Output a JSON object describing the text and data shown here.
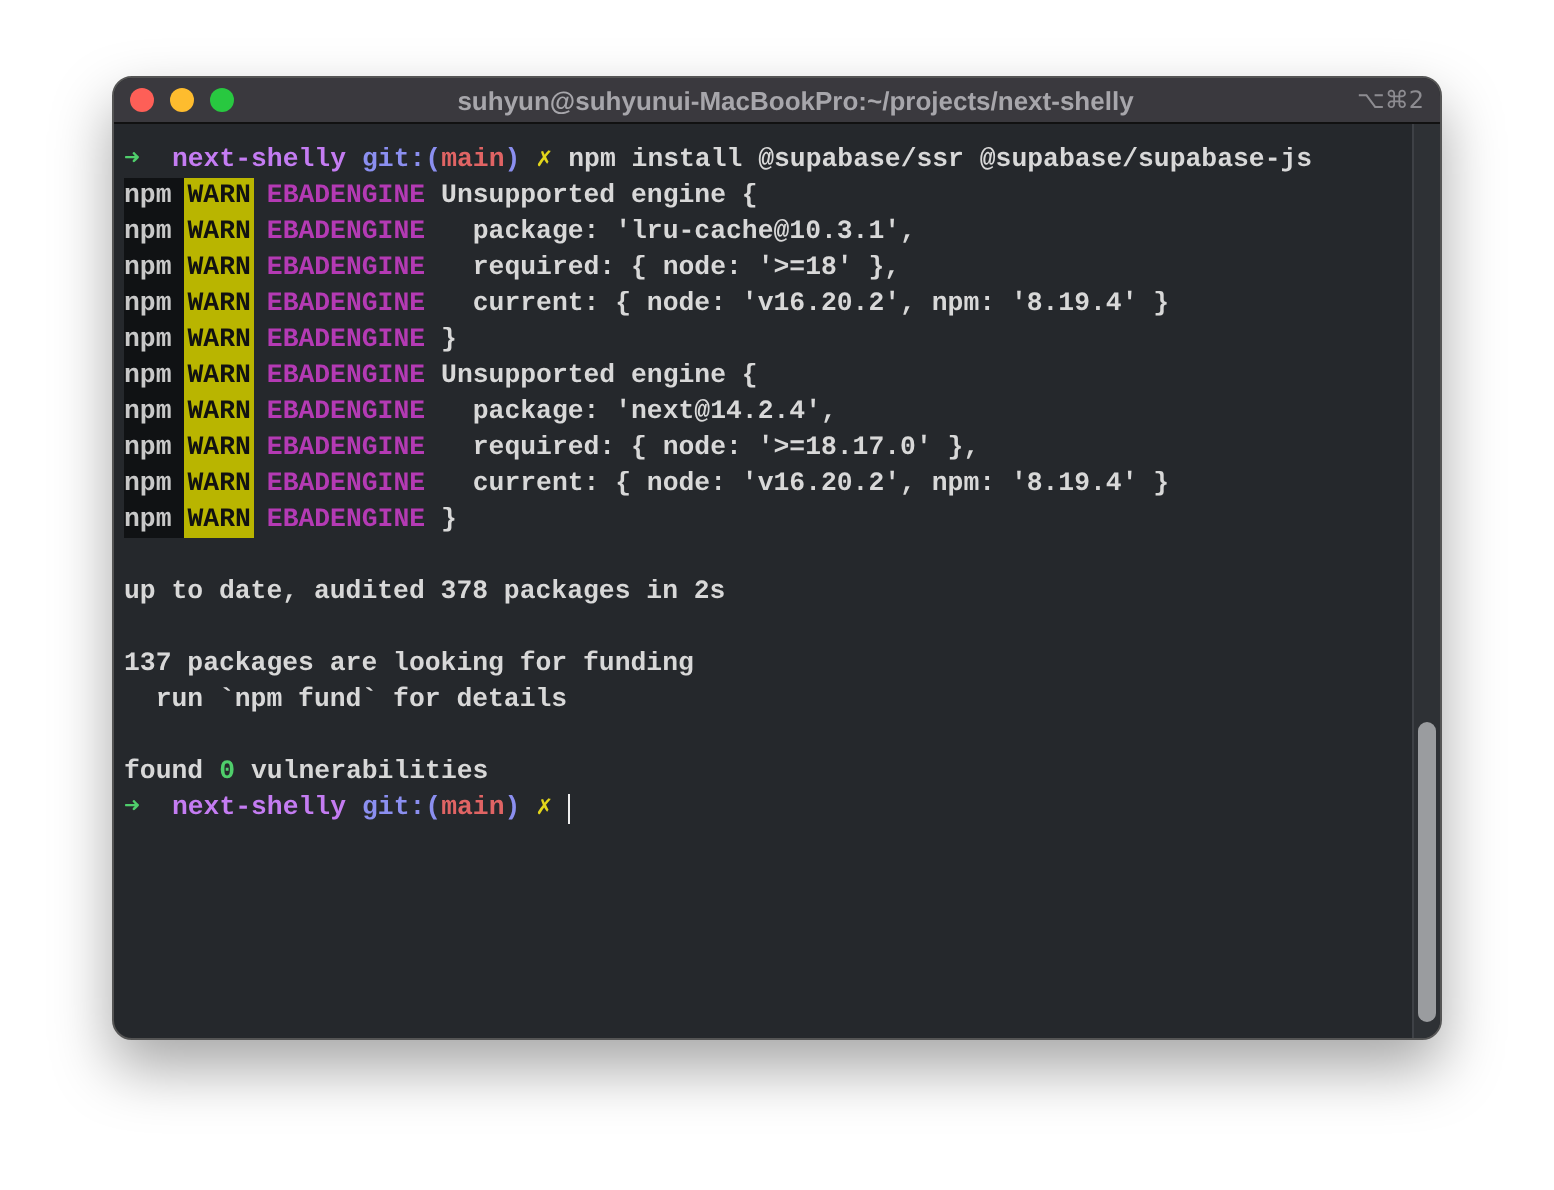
{
  "window": {
    "title": "suhyun@suhyunui-MacBookPro:~/projects/next-shelly",
    "shortcut": "⌥⌘2"
  },
  "lines": [
    {
      "kind": "prompt",
      "arrow": "➜",
      "dir": "next-shelly",
      "git_prefix": "git:(",
      "branch": "main",
      "git_suffix": ")",
      "dirty": "✗",
      "command": "npm install @supabase/ssr @supabase/supabase-js"
    },
    {
      "kind": "warn",
      "prefix": "npm",
      "level": "WARN",
      "code": "EBADENGINE",
      "message": "Unsupported engine {"
    },
    {
      "kind": "warn",
      "prefix": "npm",
      "level": "WARN",
      "code": "EBADENGINE",
      "message": "  package: 'lru-cache@10.3.1',"
    },
    {
      "kind": "warn",
      "prefix": "npm",
      "level": "WARN",
      "code": "EBADENGINE",
      "message": "  required: { node: '>=18' },"
    },
    {
      "kind": "warn",
      "prefix": "npm",
      "level": "WARN",
      "code": "EBADENGINE",
      "message": "  current: { node: 'v16.20.2', npm: '8.19.4' }"
    },
    {
      "kind": "warn",
      "prefix": "npm",
      "level": "WARN",
      "code": "EBADENGINE",
      "message": "}"
    },
    {
      "kind": "warn",
      "prefix": "npm",
      "level": "WARN",
      "code": "EBADENGINE",
      "message": "Unsupported engine {"
    },
    {
      "kind": "warn",
      "prefix": "npm",
      "level": "WARN",
      "code": "EBADENGINE",
      "message": "  package: 'next@14.2.4',"
    },
    {
      "kind": "warn",
      "prefix": "npm",
      "level": "WARN",
      "code": "EBADENGINE",
      "message": "  required: { node: '>=18.17.0' },"
    },
    {
      "kind": "warn",
      "prefix": "npm",
      "level": "WARN",
      "code": "EBADENGINE",
      "message": "  current: { node: 'v16.20.2', npm: '8.19.4' }"
    },
    {
      "kind": "warn",
      "prefix": "npm",
      "level": "WARN",
      "code": "EBADENGINE",
      "message": "}"
    },
    {
      "kind": "blank"
    },
    {
      "kind": "text",
      "text": "up to date, audited 378 packages in 2s"
    },
    {
      "kind": "blank"
    },
    {
      "kind": "text",
      "text": "137 packages are looking for funding"
    },
    {
      "kind": "text",
      "text": "  run `npm fund` for details"
    },
    {
      "kind": "blank"
    },
    {
      "kind": "found",
      "before": "found",
      "count": "0",
      "after": "vulnerabilities"
    },
    {
      "kind": "prompt",
      "arrow": "➜",
      "dir": "next-shelly",
      "git_prefix": "git:(",
      "branch": "main",
      "git_suffix": ")",
      "dirty": "✗",
      "cursor": true
    }
  ]
}
